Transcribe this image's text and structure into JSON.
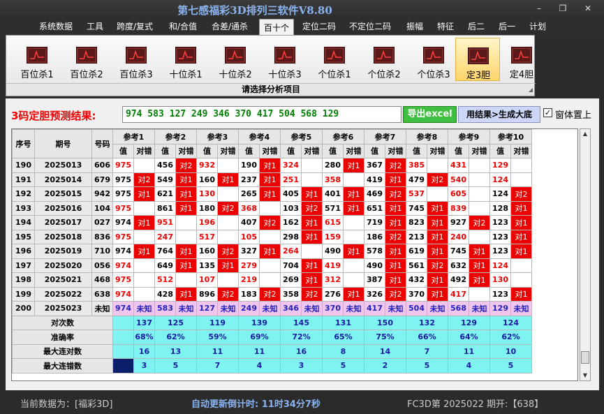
{
  "app": {
    "title": "第七感福彩3D排列三软件V8.80"
  },
  "window_buttons": {
    "minimize": "–",
    "restore": "❐",
    "close": "✕"
  },
  "menu": [
    "系统数据",
    "工具",
    "跨度/复式",
    "和/合值",
    "合差/通杀",
    "百十个",
    "定位二码",
    "不定位二码",
    "振幅",
    "特征",
    "后二",
    "后一",
    "计划"
  ],
  "menu_active": 5,
  "ribbon": {
    "buttons": [
      "百位杀1",
      "百位杀2",
      "百位杀3",
      "十位杀1",
      "十位杀2",
      "十位杀3",
      "个位杀1",
      "个位杀2",
      "个位杀3",
      "定3胆",
      "定4胆"
    ],
    "active": 9,
    "caption": "请选择分析项目",
    "icon": "chart-icon"
  },
  "prediction": {
    "label": "3码定胆预测结果:",
    "value": "974 583 127 249 346 370 417 504 568 129",
    "btn_excel": "导出excel",
    "btn_generate": "用结果>生成大底",
    "topmost_label": "窗体置上",
    "topmost_checked": "✓"
  },
  "table": {
    "head1": [
      "序号",
      "期号",
      "号码"
    ],
    "refs": [
      "参考1",
      "参考2",
      "参考3",
      "参考4",
      "参考5",
      "参考6",
      "参考7",
      "参考8",
      "参考9",
      "参考10"
    ],
    "sub": [
      "值",
      "对错"
    ],
    "rows": [
      {
        "seq": "190",
        "issue": "2025013",
        "num": "606",
        "cells": [
          [
            "975",
            "r",
            ""
          ],
          [
            "456",
            "",
            "对2"
          ],
          [
            "932",
            "r",
            ""
          ],
          [
            "190",
            "",
            "对1"
          ],
          [
            "324",
            "r",
            ""
          ],
          [
            "280",
            "",
            "对1"
          ],
          [
            "367",
            "",
            "对2"
          ],
          [
            "385",
            "r",
            ""
          ],
          [
            "431",
            "r",
            ""
          ],
          [
            "129",
            "r",
            ""
          ]
        ]
      },
      {
        "seq": "191",
        "issue": "2025014",
        "num": "679",
        "cells": [
          [
            "975",
            "",
            "对2"
          ],
          [
            "549",
            "",
            "对1"
          ],
          [
            "160",
            "",
            "对1"
          ],
          [
            "237",
            "",
            "对1"
          ],
          [
            "251",
            "r",
            ""
          ],
          [
            "358",
            "r",
            ""
          ],
          [
            "419",
            "",
            "对1"
          ],
          [
            "479",
            "",
            "对2"
          ],
          [
            "540",
            "r",
            ""
          ],
          [
            "124",
            "r",
            ""
          ]
        ]
      },
      {
        "seq": "192",
        "issue": "2025015",
        "num": "942",
        "cells": [
          [
            "975",
            "",
            "对1"
          ],
          [
            "621",
            "",
            "对1"
          ],
          [
            "130",
            "r",
            ""
          ],
          [
            "265",
            "",
            "对1"
          ],
          [
            "405",
            "",
            "对1"
          ],
          [
            "401",
            "",
            "对1"
          ],
          [
            "469",
            "",
            "对2"
          ],
          [
            "537",
            "r",
            ""
          ],
          [
            "605",
            "r",
            ""
          ],
          [
            "124",
            "",
            "对2"
          ]
        ]
      },
      {
        "seq": "193",
        "issue": "2025016",
        "num": "104",
        "cells": [
          [
            "975",
            "r",
            ""
          ],
          [
            "861",
            "",
            "对1"
          ],
          [
            "180",
            "",
            "对2"
          ],
          [
            "368",
            "r",
            ""
          ],
          [
            "103",
            "",
            "对2"
          ],
          [
            "571",
            "",
            "对1"
          ],
          [
            "651",
            "",
            "对1"
          ],
          [
            "745",
            "",
            "对1"
          ],
          [
            "839",
            "r",
            ""
          ],
          [
            "128",
            "",
            "对1"
          ]
        ]
      },
      {
        "seq": "194",
        "issue": "2025017",
        "num": "027",
        "cells": [
          [
            "974",
            "",
            "对1"
          ],
          [
            "951",
            "r",
            ""
          ],
          [
            "196",
            "r",
            ""
          ],
          [
            "407",
            "",
            "对2"
          ],
          [
            "162",
            "",
            "对1"
          ],
          [
            "615",
            "r",
            ""
          ],
          [
            "719",
            "",
            "对1"
          ],
          [
            "823",
            "",
            "对1"
          ],
          [
            "927",
            "",
            "对2"
          ],
          [
            "123",
            "",
            "对1"
          ]
        ]
      },
      {
        "seq": "195",
        "issue": "2025018",
        "num": "836",
        "cells": [
          [
            "975",
            "r",
            ""
          ],
          [
            "247",
            "r",
            ""
          ],
          [
            "517",
            "r",
            ""
          ],
          [
            "105",
            "r",
            ""
          ],
          [
            "298",
            "",
            "对1"
          ],
          [
            "159",
            "r",
            ""
          ],
          [
            "186",
            "",
            "对2"
          ],
          [
            "213",
            "",
            "对1"
          ],
          [
            "240",
            "r",
            ""
          ],
          [
            "123",
            "",
            "对1"
          ]
        ]
      },
      {
        "seq": "196",
        "issue": "2025019",
        "num": "710",
        "cells": [
          [
            "974",
            "",
            "对1"
          ],
          [
            "764",
            "",
            "对1"
          ],
          [
            "160",
            "",
            "对2"
          ],
          [
            "327",
            "",
            "对1"
          ],
          [
            "264",
            "r",
            ""
          ],
          [
            "490",
            "",
            "对1"
          ],
          [
            "578",
            "",
            "对1"
          ],
          [
            "619",
            "",
            "对1"
          ],
          [
            "745",
            "",
            "对1"
          ],
          [
            "123",
            "",
            "对1"
          ]
        ]
      },
      {
        "seq": "197",
        "issue": "2025020",
        "num": "056",
        "cells": [
          [
            "974",
            "r",
            ""
          ],
          [
            "649",
            "",
            "对1"
          ],
          [
            "135",
            "",
            "对1"
          ],
          [
            "279",
            "r",
            ""
          ],
          [
            "704",
            "",
            "对1"
          ],
          [
            "419",
            "r",
            ""
          ],
          [
            "490",
            "",
            "对1"
          ],
          [
            "561",
            "",
            "对2"
          ],
          [
            "632",
            "",
            "对1"
          ],
          [
            "124",
            "r",
            ""
          ]
        ]
      },
      {
        "seq": "198",
        "issue": "2025021",
        "num": "468",
        "cells": [
          [
            "975",
            "r",
            ""
          ],
          [
            "512",
            "r",
            ""
          ],
          [
            "107",
            "r",
            ""
          ],
          [
            "219",
            "r",
            ""
          ],
          [
            "269",
            "",
            "对1"
          ],
          [
            "312",
            "r",
            ""
          ],
          [
            "387",
            "",
            "对1"
          ],
          [
            "432",
            "",
            "对1"
          ],
          [
            "492",
            "",
            "对1"
          ],
          [
            "130",
            "r",
            ""
          ]
        ]
      },
      {
        "seq": "199",
        "issue": "2025022",
        "num": "638",
        "cells": [
          [
            "974",
            "r",
            ""
          ],
          [
            "428",
            "",
            "对1"
          ],
          [
            "896",
            "",
            "对2"
          ],
          [
            "183",
            "",
            "对2"
          ],
          [
            "358",
            "",
            "对2"
          ],
          [
            "276",
            "",
            "对1"
          ],
          [
            "326",
            "",
            "对2"
          ],
          [
            "370",
            "",
            "对1"
          ],
          [
            "417",
            "r",
            ""
          ],
          [
            "123",
            "",
            "对1"
          ]
        ]
      }
    ],
    "future": {
      "seq": "200",
      "issue": "2025023",
      "num": "未知",
      "vals": [
        "974",
        "583",
        "127",
        "249",
        "346",
        "370",
        "417",
        "504",
        "568",
        "129"
      ],
      "status": "未知"
    },
    "stats": [
      {
        "label": "对次数",
        "vals": [
          "137",
          "125",
          "119",
          "139",
          "145",
          "131",
          "150",
          "132",
          "129",
          "124"
        ]
      },
      {
        "label": "准确率",
        "vals": [
          "68%",
          "62%",
          "59%",
          "69%",
          "72%",
          "65%",
          "75%",
          "66%",
          "64%",
          "62%"
        ]
      },
      {
        "label": "最大连对数",
        "vals": [
          "16",
          "13",
          "11",
          "11",
          "16",
          "8",
          "14",
          "7",
          "11",
          "10"
        ]
      },
      {
        "label": "最大连错数",
        "vals": [
          "3",
          "5",
          "7",
          "4",
          "3",
          "5",
          "2",
          "5",
          "4",
          "5"
        ]
      }
    ]
  },
  "status": {
    "current_data": "当前数据为：[福彩3D]",
    "countdown": "自动更新倒计时:  11时34分7秒",
    "issue_info": "FC3D第 2025022 期开:【638】"
  }
}
